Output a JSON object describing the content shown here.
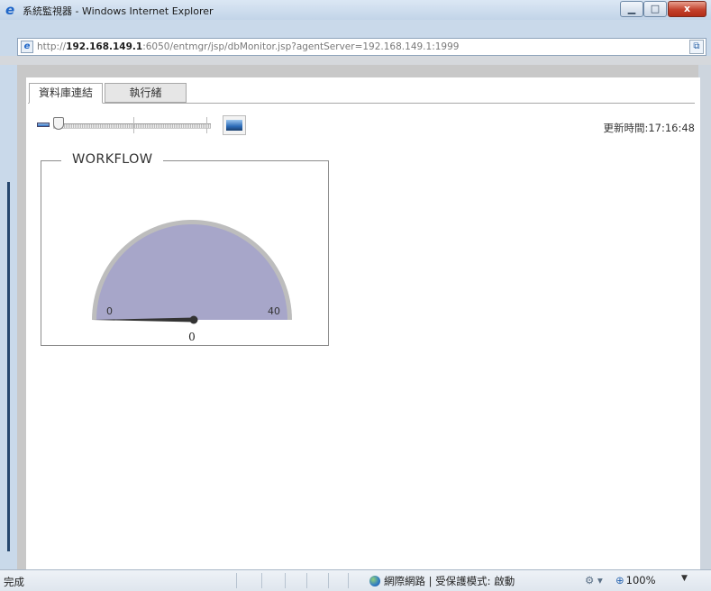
{
  "window": {
    "title": "系統監視器 - Windows Internet Explorer",
    "min_icon": "minimize-icon",
    "max_icon": "maximize-icon",
    "close_label": "x"
  },
  "address": {
    "url_prefix": "http://",
    "url_host": "192.168.149.1",
    "url_rest": ":6050/entmgr/jsp/dbMonitor.jsp?agentServer=192.168.149.1:1999"
  },
  "tabs": [
    {
      "label": "資料庫連結",
      "active": true
    },
    {
      "label": "執行緒",
      "active": false
    }
  ],
  "toolbar": {
    "update_time": "更新時間:17:16:48",
    "zoom_level": 0
  },
  "panel": {
    "title": "WORKFLOW",
    "gauge": {
      "min_label": "0",
      "max_label": "40",
      "value_label": "0",
      "value": 0,
      "min": 0,
      "max": 40,
      "fill_color": "#a7a6c9",
      "rim_color": "#bdbdbd",
      "needle_color": "#333333"
    }
  },
  "statusbar": {
    "status_text": "完成",
    "zone_text": "網際網路 | 受保護模式: 啟動",
    "zoom_text": "100%",
    "zoom_arrow": "▼"
  }
}
